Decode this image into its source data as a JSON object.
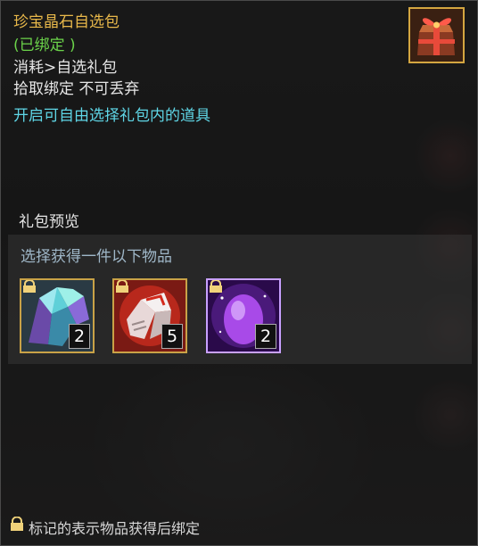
{
  "item": {
    "title": "珍宝晶石自选包",
    "bound_status": "(已绑定 )",
    "category": "消耗>自选礼包",
    "bind_rule": "拾取绑定 不可丢弃",
    "description": "开启可自由选择礼包内的道具",
    "icon": "gift-box-icon"
  },
  "preview": {
    "label": "礼包预览",
    "subtitle": "选择获得一件以下物品",
    "rewards": [
      {
        "icon": "crystal-cluster-icon",
        "count": "2",
        "locked": true,
        "frame": "#c9a247"
      },
      {
        "icon": "red-gauntlet-icon",
        "count": "5",
        "locked": true,
        "frame": "#c9a247"
      },
      {
        "icon": "purple-egg-icon",
        "count": "2",
        "locked": true,
        "frame": "#c8a0ff"
      }
    ]
  },
  "footer": {
    "note": "标记的表示物品获得后绑定"
  },
  "colors": {
    "title": "#e8b84a",
    "bound": "#6bd34a",
    "description": "#5fd6e6",
    "subtitle": "#9fb7c8"
  }
}
